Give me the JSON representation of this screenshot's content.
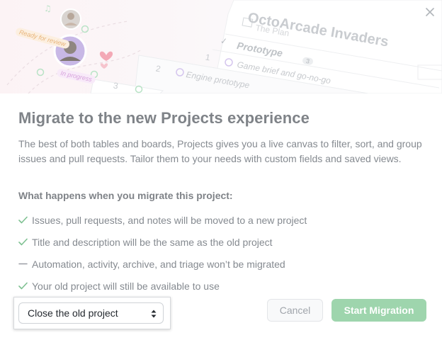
{
  "illustration": {
    "project_title": "OctoArcade Invaders",
    "view_label": "The Plan",
    "group_label": "Prototype",
    "group_count": "3",
    "rows": [
      {
        "num": "1",
        "text": "Game brief and go-no-go"
      },
      {
        "num": "2",
        "text": "Engine prototype"
      },
      {
        "num": "3",
        "text": ""
      }
    ],
    "tags": {
      "review": "Ready for review",
      "progress": "In progress"
    },
    "colors": {
      "review": "#e8b47a",
      "progress": "#d7a3dc",
      "accent": "#9ed5ad"
    }
  },
  "dialog": {
    "close_icon": "close-icon",
    "title": "Migrate to the new Projects experience",
    "description": "The best of both tables and boards, Projects gives you a live canvas to filter, sort, and group issues and pull requests. Tailor them to your needs with custom fields and saved views.",
    "subheading": "What happens when you migrate this project:",
    "items": [
      {
        "icon": "check-icon",
        "text": "Issues, pull requests, and notes will be moved to a new project"
      },
      {
        "icon": "check-icon",
        "text": "Title and description will be the same as the old project"
      },
      {
        "icon": "dash-icon",
        "text": "Automation, activity, archive, and triage won’t be migrated"
      },
      {
        "icon": "check-icon",
        "text": "Your old project will still be available to use"
      }
    ]
  },
  "footer": {
    "select_value": "Close the old project",
    "cancel_label": "Cancel",
    "start_label": "Start Migration"
  }
}
